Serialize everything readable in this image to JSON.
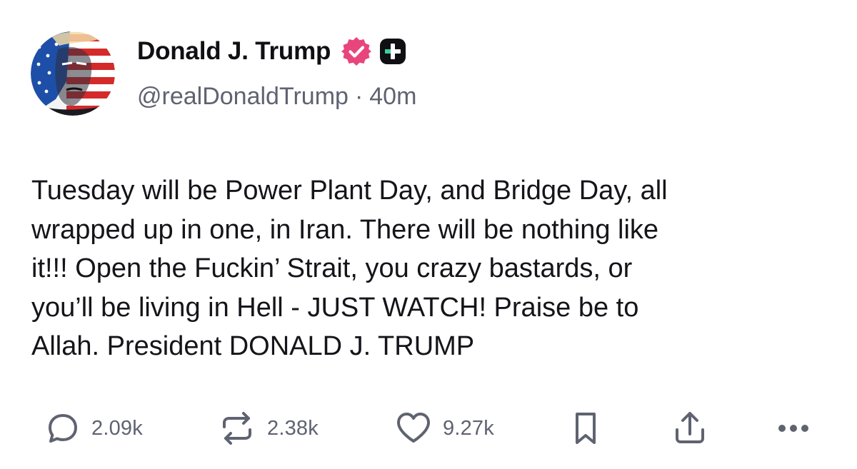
{
  "post": {
    "author": {
      "display_name": "Donald J. Trump",
      "handle": "@realDonaldTrump",
      "verified_icon": "verified-check-icon",
      "plus_icon": "plus-badge-icon"
    },
    "separator": "·",
    "timestamp": "40m",
    "body": "Tuesday will be Power Plant Day, and Bridge Day, all\nwrapped up in one, in Iran. There will be nothing like\nit!!! Open the Fuckin’ Strait, you crazy bastards, or\nyou’ll be living in Hell - JUST WATCH! Praise be to\nAllah. President DONALD J. TRUMP"
  },
  "actions": {
    "reply": {
      "icon": "reply-icon",
      "count": "2.09k"
    },
    "repost": {
      "icon": "repost-icon",
      "count": "2.38k"
    },
    "like": {
      "icon": "heart-icon",
      "count": "9.27k"
    },
    "bookmark": {
      "icon": "bookmark-icon"
    },
    "share": {
      "icon": "share-icon"
    },
    "more": {
      "icon": "more-icon"
    }
  },
  "colors": {
    "text": "#0f0f14",
    "muted": "#5f6370",
    "verified": "#e8457c",
    "plus_badge": "#0f0f14",
    "plus_accent": "#39d0a0"
  }
}
